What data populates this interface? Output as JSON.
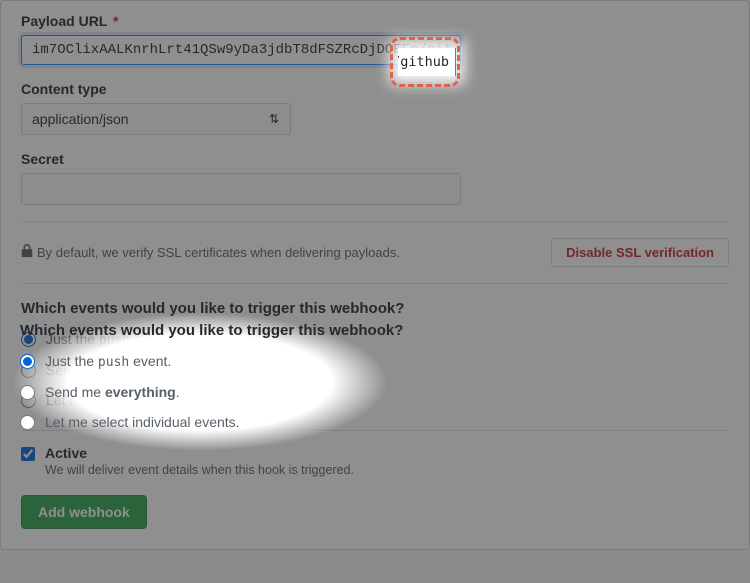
{
  "payload_url": {
    "label": "Payload URL",
    "required_mark": "*",
    "value": "im7OClixAALKnrhLrt41QSw9yDa3jdbT8dFSZRcDjDOEEp/github",
    "highlight_tail": "p/github"
  },
  "content_type": {
    "label": "Content type",
    "value": "application/json"
  },
  "secret": {
    "label": "Secret",
    "value": ""
  },
  "ssl": {
    "note": "By default, we verify SSL certificates when delivering payloads.",
    "disable_button": "Disable SSL verification"
  },
  "events": {
    "heading": "Which events would you like to trigger this webhook?",
    "options": {
      "push_pre": "Just the ",
      "push_code": "push",
      "push_post": " event.",
      "everything_pre": "Send me ",
      "everything_strong": "everything",
      "everything_post": ".",
      "individual": "Let me select individual events."
    },
    "selected": "push"
  },
  "active": {
    "label": "Active",
    "desc": "We will deliver event details when this hook is triggered.",
    "checked": true
  },
  "submit": {
    "label": "Add webhook"
  }
}
